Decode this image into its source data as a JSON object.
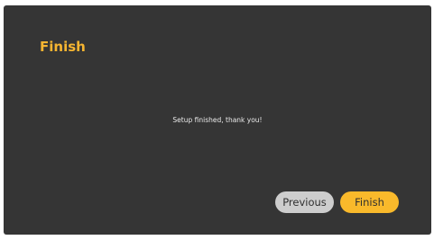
{
  "page": {
    "title": "Finish",
    "message": "Setup finished, thank you!"
  },
  "buttons": {
    "previous_label": "Previous",
    "finish_label": "Finish"
  },
  "colors": {
    "background": "#353535",
    "accent": "#f9b92b",
    "secondary_button": "#cdcdcd"
  }
}
